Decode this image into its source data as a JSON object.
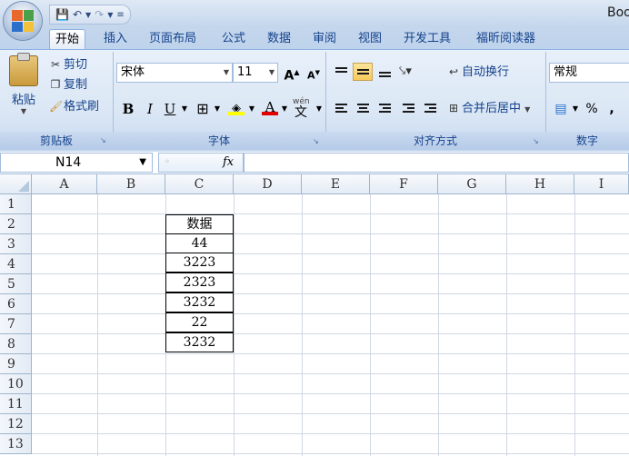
{
  "app": {
    "title": "Boo",
    "quick_access": [
      "save",
      "undo",
      "redo",
      "customize"
    ]
  },
  "tabs": [
    {
      "label": "开始",
      "active": true
    },
    {
      "label": "插入"
    },
    {
      "label": "页面布局"
    },
    {
      "label": "公式"
    },
    {
      "label": "数据"
    },
    {
      "label": "审阅"
    },
    {
      "label": "视图"
    },
    {
      "label": "开发工具"
    },
    {
      "label": "福昕阅读器"
    }
  ],
  "ribbon": {
    "clipboard": {
      "label": "剪贴板",
      "paste": "粘贴",
      "cut": "剪切",
      "copy": "复制",
      "format_painter": "格式刷"
    },
    "font": {
      "label": "字体",
      "font_name": "宋体",
      "font_size": "11",
      "bold": "B",
      "italic": "I",
      "underline": "U",
      "phonetic": "wén"
    },
    "alignment": {
      "label": "对齐方式",
      "wrap_text": "自动换行",
      "merge_center": "合并后居中"
    },
    "number": {
      "label": "数字",
      "format": "常规",
      "percent": "%",
      "comma": ","
    }
  },
  "formula_bar": {
    "name_box": "N14",
    "fx": "fx",
    "formula": ""
  },
  "sheet": {
    "columns": [
      "A",
      "B",
      "C",
      "D",
      "E",
      "F",
      "G",
      "H",
      "I"
    ],
    "rows": [
      "1",
      "2",
      "3",
      "4",
      "5",
      "6",
      "7",
      "8",
      "9",
      "10",
      "11",
      "12",
      "13"
    ],
    "data_cells": [
      {
        "ref": "C2",
        "value": "数据"
      },
      {
        "ref": "C3",
        "value": "44"
      },
      {
        "ref": "C4",
        "value": "3223"
      },
      {
        "ref": "C5",
        "value": "2323"
      },
      {
        "ref": "C6",
        "value": "3232"
      },
      {
        "ref": "C7",
        "value": "22"
      },
      {
        "ref": "C8",
        "value": "3232"
      }
    ]
  },
  "colors": {
    "ribbon_bg": "#dbe7f5",
    "tab_text": "#15428b",
    "gridline": "#d0d7e5",
    "highlight": "#f8c95b",
    "font_color_bar": "#e00000",
    "fill_color_bar": "#ffff00"
  }
}
